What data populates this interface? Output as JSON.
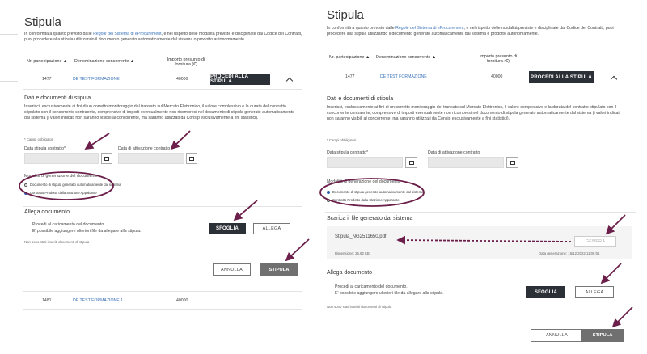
{
  "colors": {
    "accent": "#3b73b9",
    "annotation": "#6b1f4a",
    "dark_button": "#2b2f36",
    "gray_button": "#707070"
  },
  "left": {
    "title": "Stipula",
    "intro_pre": "In conformità a quanto previsto dalle ",
    "intro_link": "Regole del Sistema di eProcurement",
    "intro_post": ", e nel rispetto delle modalità previste e disciplinate dal Codice dei Contratti, puoi procedere alla stipula utilizzando il documento generato automaticamente dal sistema o prodotto autonomamente.",
    "col_partecipazione": "Nr. partecipazione ▲",
    "col_denominazione": "Denominazione concorrente ▲",
    "col_importo": "Importo presunto di fornitura (€)",
    "row1": {
      "nr": "1477",
      "name": "DE TEST FORMAZIONE",
      "importo": "40000",
      "action": "PROCEDI ALLA STIPULA"
    },
    "dati_title": "Dati e documenti di stipula",
    "dati_text": "Inserisci, esclusivamente ai fini di un corretto monitoraggio del transato sul Mercato Elettronico, il valore complessivo e la durata del contratto stipulato con il concorrente contraente, comprensivo di importi eventualmente non ricompresi nel documento di stipula generato automaticamente dal sistema (i valori indicati non saranno visibili al concorrente, ma saranno utilizzati da Consip esclusivamente a fini statistici).",
    "required_note": "* Campi obbligatori",
    "data_stipula_label": "Data stipula contratto*",
    "data_attivazione_label": "Data di attivazione contratto",
    "modalita_title": "Modalità di generazione del documento",
    "option_auto": "Documento di stipula generato automaticamente dal sistema",
    "option_soggetto": "Contratto Prodotto dalla Stazione Appaltante",
    "allega_title": "Allega documento",
    "allega_text1": "Procedi al caricamento del documento.",
    "allega_text2": "E' possibile aggiungere ulteriori file da allegare alla stipula.",
    "sfoglia": "SFOGLIA",
    "allega": "ALLEGA",
    "no_docs": "Non sono stati inseriti documenti di stipula",
    "annulla": "ANNULLA",
    "stipula": "STIPULA",
    "row2": {
      "nr": "1481",
      "name": "DE TEST FORMAZIONE 1",
      "importo": "40000"
    }
  },
  "right": {
    "title": "Stipula",
    "intro_pre": "In conformità a quanto previsto dalle ",
    "intro_link": "Regole del Sistema di eProcurement",
    "intro_post": ", e nel rispetto delle modalità previste e disciplinate dal Codice dei Contratti, puoi procedere alla stipula utilizzando il documento generato automaticamente dal sistema o prodotto autonomamente.",
    "col_partecipazione": "Nr. partecipazione ▲",
    "col_denominazione": "Denominazione concorrente ▲",
    "col_importo": "Importo presunto di fornitura (€)",
    "row1": {
      "nr": "1477",
      "name": "DE TEST FORMAZIONE",
      "importo": "40000",
      "action": "PROCEDI ALLA STIPULA"
    },
    "dati_title": "Dati e documenti di stipula",
    "dati_text": "Inserisci, esclusivamente ai fini di un corretto monitoraggio del transato sul Mercato Elettronico, il valore complessivo e la durata del contratto stipulato con il concorrente contraente, comprensivo di importi eventualmente non ricompresi nel documento di stipula generato automaticamente dal sistema (i valori indicati non saranno visibili al concorrente, ma saranno utilizzati da Consip esclusivamente a fini statistici).",
    "required_note": "* Campi obbligatori",
    "data_stipula_label": "Data stipula contratto*",
    "data_attivazione_label": "Data di attivazione contratto",
    "modalita_title": "Modalità di generazione del documento",
    "option_auto": "Documento di stipula generato automaticamente dal sistema",
    "option_soggetto": "Contratto Prodotto dalla Stazione Appaltante",
    "scarica_title": "Scarica il file generato dal sistema",
    "file_name": "Stipula_NG2511650.pdf",
    "genera": "GENERA",
    "dimensione": "Dimensione: 25.92 KB",
    "data_generazione": "Data generazione: 15/12/2022 11:06:01",
    "allega_title": "Allega documento",
    "allega_text1": "Procedi al caricamento del documento.",
    "allega_text2": "E' possibile aggiungere ulteriori file da allegare alla stipula.",
    "sfoglia": "SFOGLIA",
    "allega": "ALLEGA",
    "no_docs": "Non sono stati inseriti documenti di stipula",
    "annulla": "ANNULLA",
    "stipula": "STIPULA"
  }
}
